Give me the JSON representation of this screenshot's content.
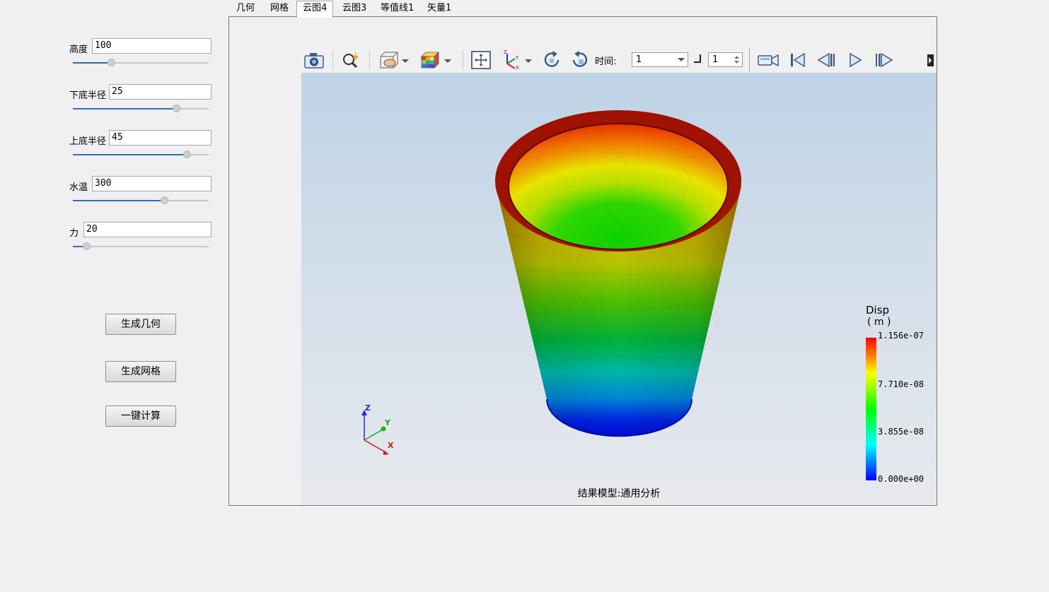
{
  "params": [
    {
      "label": "高度",
      "value": "100",
      "fraction": 0.28
    },
    {
      "label": "下底半径",
      "value": "25",
      "fraction": 0.76
    },
    {
      "label": "上底半径",
      "value": "45",
      "fraction": 0.84
    },
    {
      "label": "水温",
      "value": "300",
      "fraction": 0.67
    },
    {
      "label": "力",
      "value": "20",
      "fraction": 0.1
    }
  ],
  "buttons": {
    "generate_geometry": "生成几何",
    "generate_mesh": "生成网格",
    "one_click_compute": "一键计算"
  },
  "tabs": [
    {
      "label": "几何",
      "active": false
    },
    {
      "label": "网格",
      "active": false
    },
    {
      "label": "云图4",
      "active": true
    },
    {
      "label": "云图3",
      "active": false
    },
    {
      "label": "等值线1",
      "active": false
    },
    {
      "label": "矢量1",
      "active": false
    }
  ],
  "toolbar": {
    "time_label": "时间:",
    "time_value": "1",
    "step_value": "1",
    "icons": [
      "camera-icon",
      "zoom-icon",
      "display-mode-icon",
      "color-cube-icon",
      "fit-view-icon",
      "axes-icon",
      "rotate-icon",
      "reset-rotate-icon",
      "record-icon",
      "first-frame-icon",
      "previous-frame-icon",
      "play-icon",
      "next-frame-icon"
    ]
  },
  "viewport": {
    "caption": "结果模型:通用分析",
    "axes": {
      "z": "Z",
      "y": "Y",
      "x": "X"
    },
    "colorbar": {
      "title": "Disp",
      "unit": "( m )",
      "ticks": [
        "1.156e-07",
        "7.710e-08",
        "3.855e-08",
        "0.000e+00"
      ],
      "colors": [
        "#ff0000",
        "#ffff00",
        "#00ff00",
        "#00ffff",
        "#0000ff"
      ]
    }
  },
  "colors": {
    "accent": "#2f6fb3",
    "background": "#f0f0f0"
  }
}
